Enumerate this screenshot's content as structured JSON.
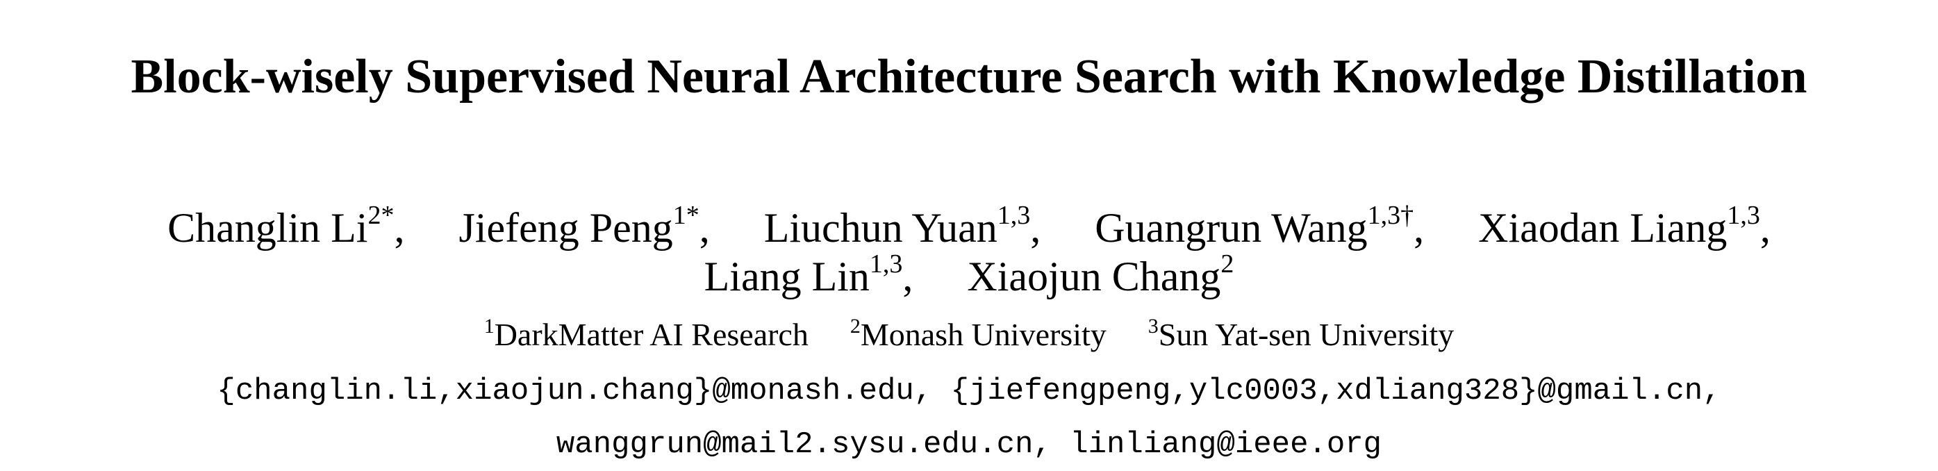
{
  "paper": {
    "title": "Block-wisely Supervised Neural Architecture Search with Knowledge Distillation",
    "authors_line1": [
      {
        "name": "Changlin Li",
        "sup": "2*",
        "sep": ","
      },
      {
        "name": "Jiefeng Peng",
        "sup": "1*",
        "sep": ","
      },
      {
        "name": "Liuchun Yuan",
        "sup": "1,3",
        "sep": ","
      },
      {
        "name": "Guangrun Wang",
        "sup": "1,3†",
        "sep": ","
      },
      {
        "name": "Xiaodan Liang",
        "sup": "1,3",
        "sep": ","
      }
    ],
    "authors_line2": [
      {
        "name": "Liang Lin",
        "sup": "1,3",
        "sep": ","
      },
      {
        "name": "Xiaojun Chang",
        "sup": "2",
        "sep": ""
      }
    ],
    "affiliations": [
      {
        "sup": "1",
        "name": "DarkMatter AI Research"
      },
      {
        "sup": "2",
        "name": "Monash University"
      },
      {
        "sup": "3",
        "name": "Sun Yat-sen University"
      }
    ],
    "emails_line1": "{changlin.li,xiaojun.chang}@monash.edu, {jiefengpeng,ylc0003,xdliang328}@gmail.cn,",
    "emails_line2": "wanggrun@mail2.sysu.edu.cn, linliang@ieee.org"
  }
}
